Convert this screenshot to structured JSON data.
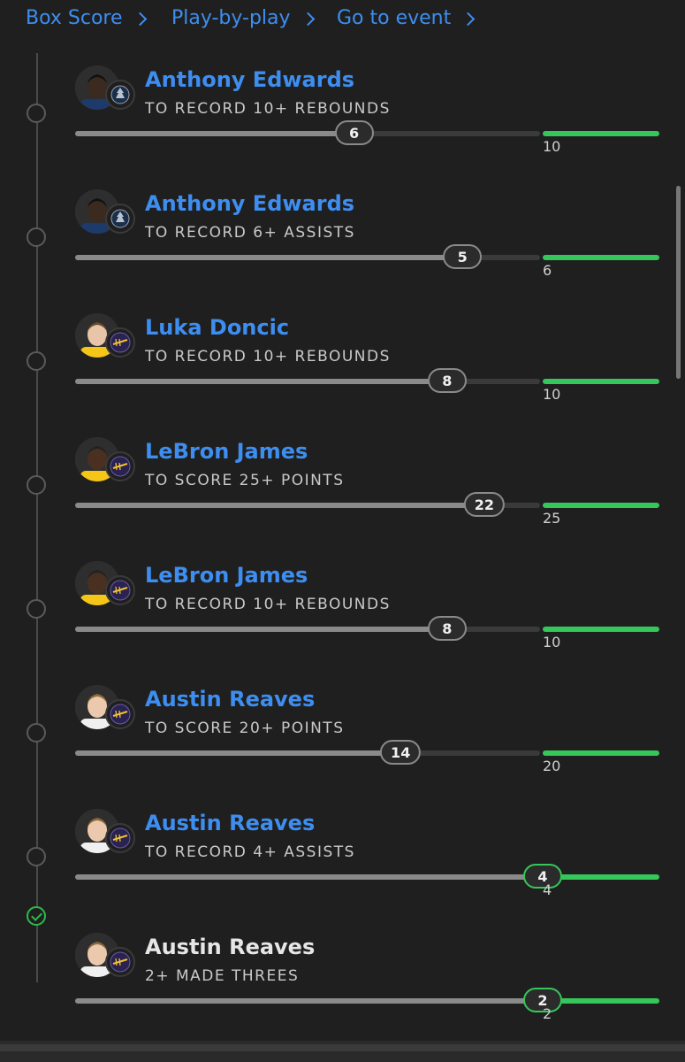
{
  "nav": {
    "links": [
      {
        "label": "Box Score"
      },
      {
        "label": "Play-by-play"
      },
      {
        "label": "Go to event"
      }
    ]
  },
  "props": [
    {
      "player": "Anthony Edwards",
      "team": "timberwolves-logo",
      "label": "TO RECORD 10+ REBOUNDS",
      "current": "6",
      "target": "10",
      "progress": 0.6,
      "settled": false
    },
    {
      "player": "Anthony Edwards",
      "team": "timberwolves-logo",
      "label": "TO RECORD 6+ ASSISTS",
      "current": "5",
      "target": "6",
      "progress": 0.833,
      "settled": false
    },
    {
      "player": "Luka Doncic",
      "team": "lakers-logo",
      "label": "TO RECORD 10+ REBOUNDS",
      "current": "8",
      "target": "10",
      "progress": 0.8,
      "settled": false
    },
    {
      "player": "LeBron James",
      "team": "lakers-logo",
      "label": "TO SCORE 25+ POINTS",
      "current": "22",
      "target": "25",
      "progress": 0.88,
      "settled": false
    },
    {
      "player": "LeBron James",
      "team": "lakers-logo",
      "label": "TO RECORD 10+ REBOUNDS",
      "current": "8",
      "target": "10",
      "progress": 0.8,
      "settled": false
    },
    {
      "player": "Austin Reaves",
      "team": "lakers-logo",
      "label": "TO SCORE 20+ POINTS",
      "current": "14",
      "target": "20",
      "progress": 0.7,
      "settled": false
    },
    {
      "player": "Austin Reaves",
      "team": "lakers-logo",
      "label": "TO RECORD 4+ ASSISTS",
      "current": "4",
      "target": "4",
      "progress": 1.0,
      "settled": false
    },
    {
      "player": "Austin Reaves",
      "team": "lakers-logo",
      "label": "2+ MADE THREES",
      "current": "2",
      "target": "2",
      "progress": 1.0,
      "settled": true
    }
  ],
  "colors": {
    "accent": "#3d8ef0",
    "success": "#35c759",
    "background": "#1f1f1f"
  }
}
